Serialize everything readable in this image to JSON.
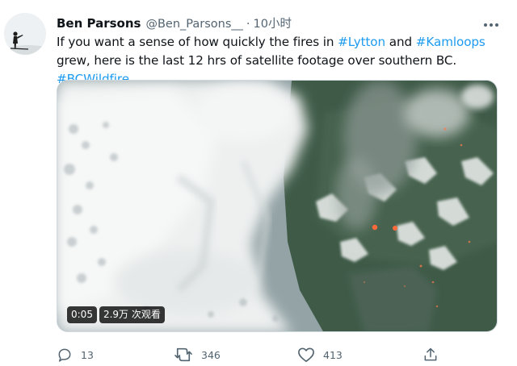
{
  "tweet": {
    "author_name": "Ben Parsons",
    "author_handle": "@Ben_Parsons__",
    "separator": "·",
    "time": "10小时",
    "text_part1": "If you want a sense of how quickly the fires in ",
    "hashtag_lytton": "#Lytton",
    "text_and": " and ",
    "hashtag_kamloops": "#Kamloops",
    "text_part2": " grew, here is the last 12 hrs of satellite footage over southern BC. ",
    "hashtag_bcwildfire": "#BCWildfire"
  },
  "video": {
    "elapsed": "0:05",
    "views": "2.9万 次观看"
  },
  "actions": {
    "reply_count": "13",
    "retweet_count": "346",
    "like_count": "413"
  },
  "icons": {
    "more": "more-icon",
    "reply": "reply-icon",
    "retweet": "retweet-icon",
    "like": "like-icon",
    "share": "share-icon"
  },
  "colors": {
    "accent": "#1d9bf0",
    "text": "#0f1419",
    "secondary": "#536471"
  }
}
